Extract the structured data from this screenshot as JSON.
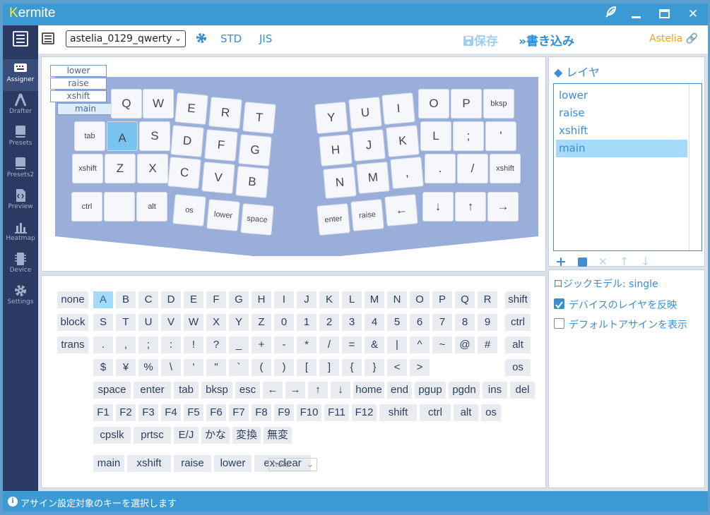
{
  "app": {
    "title_k": "K",
    "title_rest": "ermite"
  },
  "toolbar": {
    "project": "astelia_0129_qwerty",
    "std": "STD",
    "jis": "JIS",
    "save": "保存",
    "write": "書き込み",
    "device": "Astelia"
  },
  "sidebar": [
    {
      "label": "Assigner",
      "icon": "keyboard-icon"
    },
    {
      "label": "Drafter",
      "icon": "compass-icon"
    },
    {
      "label": "Presets",
      "icon": "book-icon"
    },
    {
      "label": "Presets2",
      "icon": "book-icon"
    },
    {
      "label": "Preview",
      "icon": "code-file-icon"
    },
    {
      "label": "Heatmap",
      "icon": "bar-chart-icon"
    },
    {
      "label": "Device",
      "icon": "chip-icon"
    },
    {
      "label": "Settings",
      "icon": "gear-icon"
    }
  ],
  "layer_tabs": [
    "lower",
    "raise",
    "xshift",
    "main"
  ],
  "keys": [
    "Q",
    "W",
    "E",
    "R",
    "T",
    "Y",
    "U",
    "I",
    "O",
    "P",
    "bksp",
    "tab",
    "A",
    "S",
    "D",
    "F",
    "G",
    "H",
    "J",
    "K",
    "L",
    ";",
    "'",
    "xshift",
    "Z",
    "X",
    "C",
    "V",
    "B",
    "N",
    "M",
    ",",
    ".",
    "/",
    "xshift",
    "ctrl",
    "",
    "alt",
    "os",
    "lower",
    "space",
    "enter",
    "raise",
    "←",
    "↓",
    "↑",
    "→"
  ],
  "palette": {
    "col1": [
      "none",
      "block",
      "trans"
    ],
    "row1": [
      "A",
      "B",
      "C",
      "D",
      "E",
      "F",
      "G",
      "H",
      "I",
      "J",
      "K",
      "L",
      "M",
      "N",
      "O",
      "P",
      "Q",
      "R"
    ],
    "row2": [
      "S",
      "T",
      "U",
      "V",
      "W",
      "X",
      "Y",
      "Z",
      "0",
      "1",
      "2",
      "3",
      "4",
      "5",
      "6",
      "7",
      "8",
      "9"
    ],
    "row3": [
      ".",
      ",",
      ";",
      ":",
      "!",
      "?",
      "_",
      "+",
      "-",
      "*",
      "/",
      "=",
      "&",
      "|",
      "^",
      "~",
      "@",
      "#"
    ],
    "row4": [
      "$",
      "¥",
      "%",
      "\\",
      "'",
      "\"",
      "`",
      "(",
      ")",
      "[",
      "]",
      "{",
      "}",
      "<",
      ">"
    ],
    "row5": [
      "space",
      "enter",
      "tab",
      "bksp",
      "esc",
      "←",
      "→",
      "↑",
      "↓",
      "home",
      "end",
      "pgup",
      "pgdn",
      "ins",
      "del"
    ],
    "row6": [
      "F1",
      "F2",
      "F3",
      "F4",
      "F5",
      "F6",
      "F7",
      "F8",
      "F9",
      "F10",
      "F11",
      "F12",
      "shift",
      "ctrl",
      "alt",
      "os"
    ],
    "row7": [
      "cpslk",
      "prtsc",
      "E/J",
      "かな",
      "変換",
      "無変"
    ],
    "row8": [
      "main",
      "xshift",
      "raise",
      "lower",
      "ex-clear"
    ],
    "hold": "hold",
    "mods": [
      "shift",
      "ctrl",
      "alt",
      "os"
    ]
  },
  "layers_panel": {
    "title": "レイヤ",
    "items": [
      "lower",
      "raise",
      "xshift",
      "main"
    ]
  },
  "logic": {
    "title": "ロジックモデル: single",
    "opt1": "デバイスのレイヤを反映",
    "opt2": "デフォルトアサインを表示"
  },
  "status": "アサイン設定対象のキーを選択します"
}
